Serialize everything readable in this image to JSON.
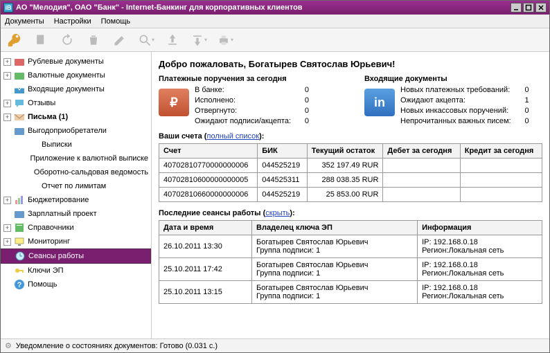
{
  "window_title": "АО \"Мелодия\", ОАО \"Банк\" - Internet-Банкинг для корпоративных клиентов",
  "menu": {
    "documents": "Документы",
    "settings": "Настройки",
    "help": "Помощь"
  },
  "tree": [
    {
      "lvl": 1,
      "exp": "+",
      "icon": "folder-red",
      "label": "Рублевые документы"
    },
    {
      "lvl": 1,
      "exp": "+",
      "icon": "folder-green",
      "label": "Валютные документы"
    },
    {
      "lvl": 1,
      "exp": "",
      "icon": "inbox-blue",
      "label": "Входящие документы"
    },
    {
      "lvl": 1,
      "exp": "+",
      "icon": "chat",
      "label": "Отзывы"
    },
    {
      "lvl": 1,
      "exp": "+",
      "icon": "mail",
      "label": "Письма (1)",
      "bold": true
    },
    {
      "lvl": 1,
      "exp": "",
      "icon": "folder-blue",
      "label": "Выгодоприобретатели"
    },
    {
      "lvl": 2,
      "exp": "",
      "icon": "",
      "label": "Выписки"
    },
    {
      "lvl": 2,
      "exp": "",
      "icon": "",
      "label": "Приложение к валютной выписке"
    },
    {
      "lvl": 2,
      "exp": "",
      "icon": "",
      "label": "Оборотно-сальдовая ведомость"
    },
    {
      "lvl": 2,
      "exp": "",
      "icon": "",
      "label": "Отчет по лимитам"
    },
    {
      "lvl": 1,
      "exp": "+",
      "icon": "chart",
      "label": "Бюджетирование"
    },
    {
      "lvl": 1,
      "exp": "",
      "icon": "folder-blue",
      "label": "Зарплатный проект"
    },
    {
      "lvl": 1,
      "exp": "+",
      "icon": "book",
      "label": "Справочники"
    },
    {
      "lvl": 1,
      "exp": "+",
      "icon": "monitor",
      "label": "Мониторинг"
    },
    {
      "lvl": 1,
      "exp": "",
      "icon": "clock",
      "label": "Сеансы работы",
      "selected": true
    },
    {
      "lvl": 1,
      "exp": "",
      "icon": "key",
      "label": "Ключи ЭП"
    },
    {
      "lvl": 1,
      "exp": "",
      "icon": "help",
      "label": "Помощь"
    }
  ],
  "welcome": "Добро пожаловать, Богатырев Святослав Юрьевич!",
  "pay_today_title": "Платежные поручения за сегодня",
  "pay_today": [
    {
      "k": "В банке:",
      "v": "0"
    },
    {
      "k": "Исполнено:",
      "v": "0"
    },
    {
      "k": "Отвергнуто:",
      "v": "0"
    },
    {
      "k": "Ожидают подписи/акцепта:",
      "v": "0"
    }
  ],
  "incoming_title": "Входящие документы",
  "incoming": [
    {
      "k": "Новых платежных требований:",
      "v": "0"
    },
    {
      "k": "Ожидают акцепта:",
      "v": "1"
    },
    {
      "k": "Новых инкассовых поручений:",
      "v": "0"
    },
    {
      "k": "Непрочитанных важных писем:",
      "v": "0"
    }
  ],
  "accounts_header_prefix": "Ваши счета",
  "accounts_link": "полный список",
  "accounts_cols": [
    "Счет",
    "БИК",
    "Текущий остаток",
    "Дебет за сегодня",
    "Кредит за сегодня"
  ],
  "accounts": [
    {
      "acc": "40702810770000000006",
      "bik": "044525219",
      "bal": "352 197.49 RUR",
      "deb": "",
      "cre": ""
    },
    {
      "acc": "40702810600000000005",
      "bik": "044525311",
      "bal": "288 038.35 RUR",
      "deb": "",
      "cre": ""
    },
    {
      "acc": "40702810660000000006",
      "bik": "044525219",
      "bal": "25 853.00 RUR",
      "deb": "",
      "cre": ""
    }
  ],
  "sessions_header_prefix": "Последние сеансы работы",
  "sessions_link": "скрыть",
  "sessions_cols": [
    "Дата и время",
    "Владелец ключа ЭП",
    "Информация"
  ],
  "sessions": [
    {
      "dt": "26.10.2011 13:30",
      "own1": "Богатырев Святослав Юрьевич",
      "own2": "Группа подписи: 1",
      "inf1": "IP: 192.168.0.18",
      "inf2": "Регион:Локальная сеть"
    },
    {
      "dt": "25.10.2011 17:42",
      "own1": "Богатырев Святослав Юрьевич",
      "own2": "Группа подписи: 1",
      "inf1": "IP: 192.168.0.18",
      "inf2": "Регион:Локальная сеть"
    },
    {
      "dt": "25.10.2011 13:15",
      "own1": "Богатырев Святослав Юрьевич",
      "own2": "Группа подписи: 1",
      "inf1": "IP: 192.168.0.18",
      "inf2": "Регион:Локальная сеть"
    }
  ],
  "status_prefix": "Уведомление о состояниях документов:",
  "status_value": "Готово (0.031 с.)"
}
